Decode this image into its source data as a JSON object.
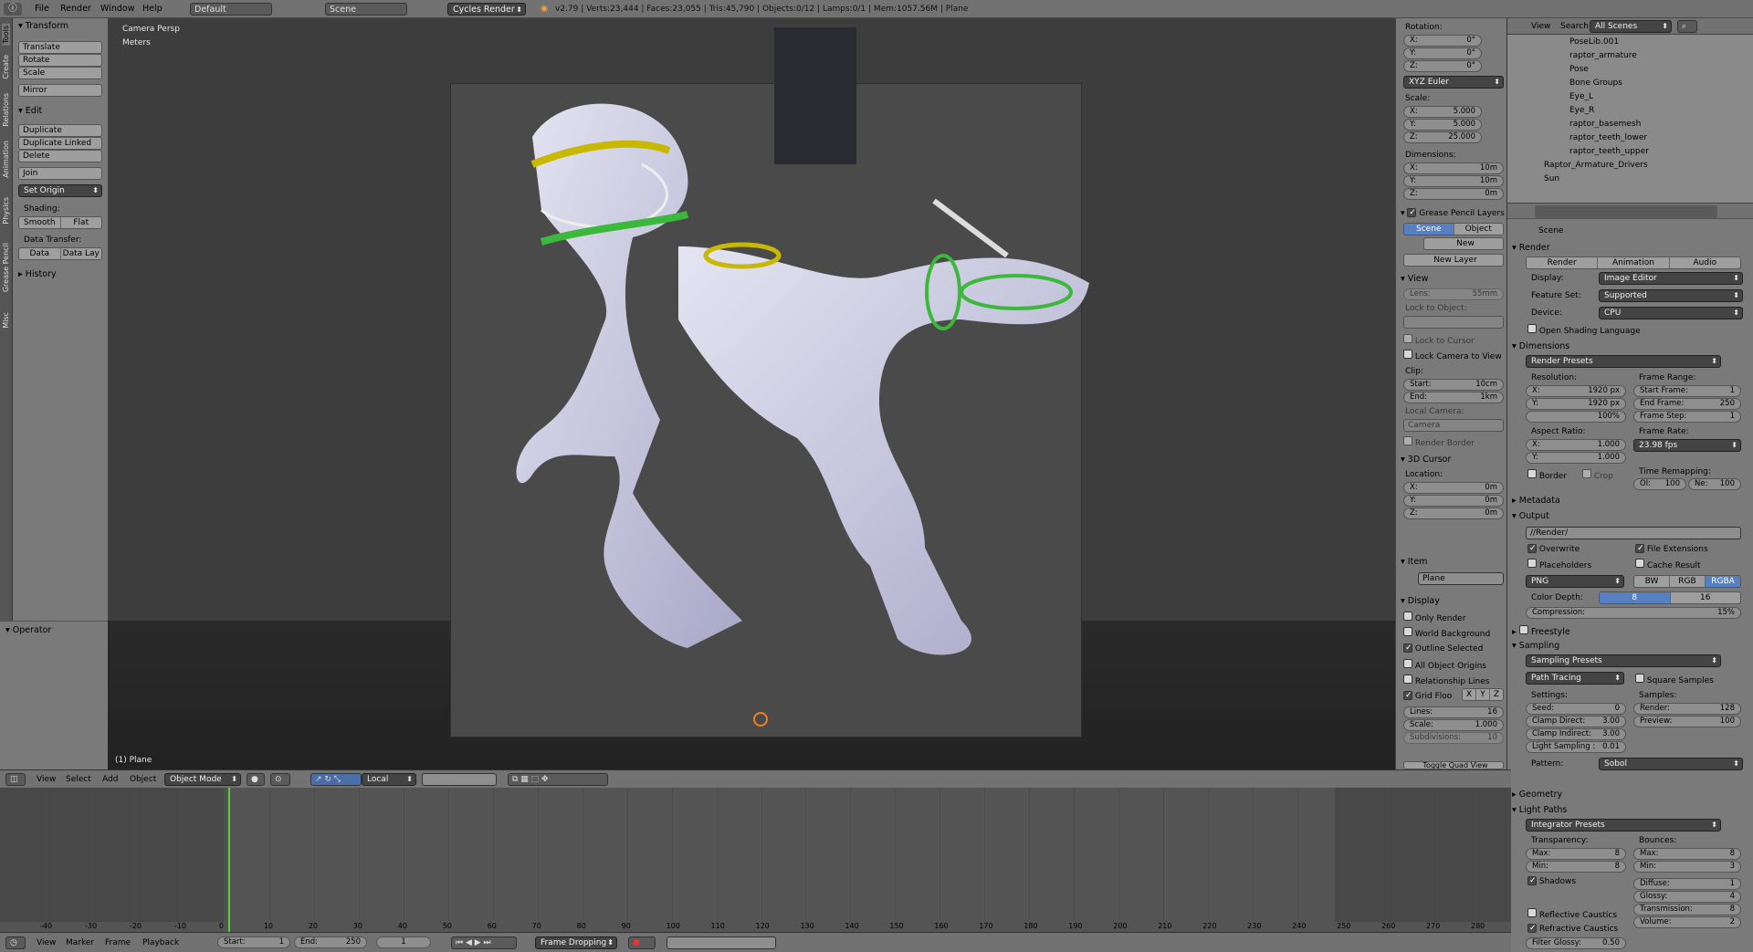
{
  "topbar": {
    "menus": [
      "File",
      "Render",
      "Window",
      "Help"
    ],
    "layout": "Default",
    "scene": "Scene",
    "engine": "Cycles Render",
    "stats": "v2.79 | Verts:23,444 | Faces:23,055 | Tris:45,790 | Objects:0/12 | Lamps:0/1 | Mem:1057.56M | Plane"
  },
  "left_tabs": [
    "Tools",
    "Create",
    "Relations",
    "Animation",
    "Physics",
    "Grease Pencil",
    "Misc"
  ],
  "toolshelf": {
    "transform": {
      "title": "Transform",
      "buttons": [
        "Translate",
        "Rotate",
        "Scale",
        "Mirror"
      ]
    },
    "edit": {
      "title": "Edit",
      "buttons": [
        "Duplicate",
        "Duplicate Linked",
        "Delete",
        "Join"
      ],
      "set_origin": "Set Origin"
    },
    "shading": {
      "label": "Shading:",
      "smooth": "Smooth",
      "flat": "Flat"
    },
    "data_transfer": {
      "label": "Data Transfer:",
      "data": "Data",
      "data_lay": "Data Lay"
    },
    "history": "History"
  },
  "operator": "Operator",
  "viewport": {
    "view_name": "Camera Persp",
    "units": "Meters",
    "object_label": "(1) Plane"
  },
  "n_panel": {
    "rotation": {
      "label": "Rotation:",
      "x": "X:",
      "xv": "0°",
      "y": "Y:",
      "yv": "0°",
      "z": "Z:",
      "zv": "0°",
      "mode": "XYZ Euler"
    },
    "scale": {
      "label": "Scale:",
      "x": "X:",
      "xv": "5.000",
      "y": "Y:",
      "yv": "5.000",
      "z": "Z:",
      "zv": "25.000"
    },
    "dimensions": {
      "label": "Dimensions:",
      "x": "X:",
      "xv": "10m",
      "y": "Y:",
      "yv": "10m",
      "z": "Z:",
      "zv": "0m"
    },
    "grease": {
      "title": "Grease Pencil Layers",
      "scene": "Scene",
      "object": "Object",
      "new": "New",
      "new_layer": "New Layer"
    },
    "view": {
      "title": "View",
      "lens": "Lens:",
      "lens_v": "55mm",
      "lock_obj": "Lock to Object:",
      "lock_cursor": "Lock to Cursor",
      "lock_camera": "Lock Camera to View",
      "clip": "Clip:",
      "start": "Start:",
      "start_v": "10cm",
      "end": "End:",
      "end_v": "1km",
      "local_camera": "Local Camera:",
      "camera": "Camera",
      "render_border": "Render Border"
    },
    "cursor": {
      "title": "3D Cursor",
      "location": "Location:",
      "x": "X:",
      "xv": "0m",
      "y": "Y:",
      "yv": "0m",
      "z": "Z:",
      "zv": "0m"
    },
    "item": {
      "title": "Item",
      "name": "Plane"
    },
    "display": {
      "title": "Display",
      "only_render": "Only Render",
      "world_bg": "World Background",
      "outline_sel": "Outline Selected",
      "all_origins": "All Object Origins",
      "rel_lines": "Relationship Lines",
      "grid_floor": "Grid Floo",
      "gx": "X",
      "gy": "Y",
      "gz": "Z",
      "lines": "Lines:",
      "lines_v": "16",
      "scale": "Scale:",
      "scale_v": "1.000",
      "subdiv": "Subdivisions:",
      "subdiv_v": "10",
      "toggle_quad": "Toggle Quad View"
    }
  },
  "outliner": {
    "view": "View",
    "search": "Search",
    "filter": "All Scenes",
    "items": [
      "PoseLib.001",
      "raptor_armature",
      "Pose",
      "Bone Groups",
      "Eye_L",
      "Eye_R",
      "raptor_basemesh",
      "raptor_teeth_lower",
      "raptor_teeth_upper",
      "Raptor_Armature_Drivers",
      "Sun"
    ]
  },
  "render_props": {
    "scene": "Scene",
    "render": {
      "title": "Render",
      "render_btn": "Render",
      "animation_btn": "Animation",
      "audio_btn": "Audio",
      "display": "Display:",
      "display_v": "Image Editor",
      "feature_set": "Feature Set:",
      "feature_set_v": "Supported",
      "device": "Device:",
      "device_v": "CPU",
      "osl": "Open Shading Language"
    },
    "dimensions": {
      "title": "Dimensions",
      "presets": "Render Presets",
      "resolution": "Resolution:",
      "rx": "X:",
      "rxv": "1920 px",
      "ry": "Y:",
      "ryv": "1920 px",
      "pct": "100%",
      "frame_range": "Frame Range:",
      "start": "Start Frame:",
      "start_v": "1",
      "end": "End Frame:",
      "end_v": "250",
      "step": "Frame Step:",
      "step_v": "1",
      "aspect": "Aspect Ratio:",
      "ax": "X:",
      "axv": "1.000",
      "ay": "Y:",
      "ayv": "1.000",
      "frame_rate": "Frame Rate:",
      "fps": "23.98 fps",
      "border": "Border",
      "crop": "Crop",
      "time_remap": "Time Remapping:",
      "ol": "Ol:",
      "ol_v": "100",
      "ne": "Ne:",
      "ne_v": "100"
    },
    "metadata": "Metadata",
    "output": {
      "title": "Output",
      "path": "//Render/",
      "overwrite": "Overwrite",
      "file_ext": "File Extensions",
      "placeholders": "Placeholders",
      "cache": "Cache Result",
      "format": "PNG",
      "bw": "BW",
      "rgb": "RGB",
      "rgba": "RGBA",
      "color_depth": "Color Depth:",
      "d8": "8",
      "d16": "16",
      "compression": "Compression:",
      "compression_v": "15%"
    },
    "freestyle": "Freestyle",
    "sampling": {
      "title": "Sampling",
      "presets": "Sampling Presets",
      "method": "Path Tracing",
      "square": "Square Samples",
      "settings": "Settings:",
      "samples": "Samples:",
      "seed": "Seed:",
      "seed_v": "0",
      "clamp_direct": "Clamp Direct:",
      "clamp_direct_v": "3.00",
      "clamp_indirect": "Clamp Indirect:",
      "clamp_indirect_v": "3.00",
      "light_sampling": "Light Sampling :",
      "light_sampling_v": "0.01",
      "render": "Render:",
      "render_v": "128",
      "preview": "Preview:",
      "preview_v": "100",
      "pattern": "Pattern:",
      "pattern_v": "Sobol"
    },
    "geometry": "Geometry",
    "light_paths": {
      "title": "Light Paths",
      "presets": "Integrator Presets",
      "transparency": "Transparency:",
      "tmax": "Max:",
      "tmax_v": "8",
      "tmin": "Min:",
      "tmin_v": "8",
      "bounces": "Bounces:",
      "bmax": "Max:",
      "bmax_v": "8",
      "bmin": "Min:",
      "bmin_v": "3",
      "shadows": "Shadows",
      "diffuse": "Diffuse:",
      "diffuse_v": "1",
      "glossy": "Glossy:",
      "glossy_v": "4",
      "transmission": "Transmission:",
      "transmission_v": "8",
      "volume": "Volume:",
      "volume_v": "2",
      "refl_caustics": "Reflective Caustics",
      "refr_caustics": "Refractive Caustics",
      "filter_glossy": "Filter Glossy:",
      "filter_glossy_v": "0.50"
    }
  },
  "vp_header": {
    "menus": [
      "View",
      "Select",
      "Add",
      "Object"
    ],
    "mode": "Object Mode",
    "pivot": "Local"
  },
  "timeline": {
    "ticks": [
      "-40",
      "-30",
      "-20",
      "-10",
      "0",
      "10",
      "20",
      "30",
      "40",
      "50",
      "60",
      "70",
      "80",
      "90",
      "100",
      "110",
      "120",
      "130",
      "140",
      "150",
      "160",
      "170",
      "180",
      "190",
      "200",
      "210",
      "220",
      "230",
      "240",
      "250",
      "260",
      "270",
      "280"
    ],
    "current_frame": 1
  },
  "tl_footer": {
    "menus": [
      "View",
      "Marker",
      "Frame",
      "Playback"
    ],
    "start": "Start:",
    "start_v": "1",
    "end": "End:",
    "end_v": "250",
    "frame": "1",
    "sync": "Frame Dropping"
  }
}
